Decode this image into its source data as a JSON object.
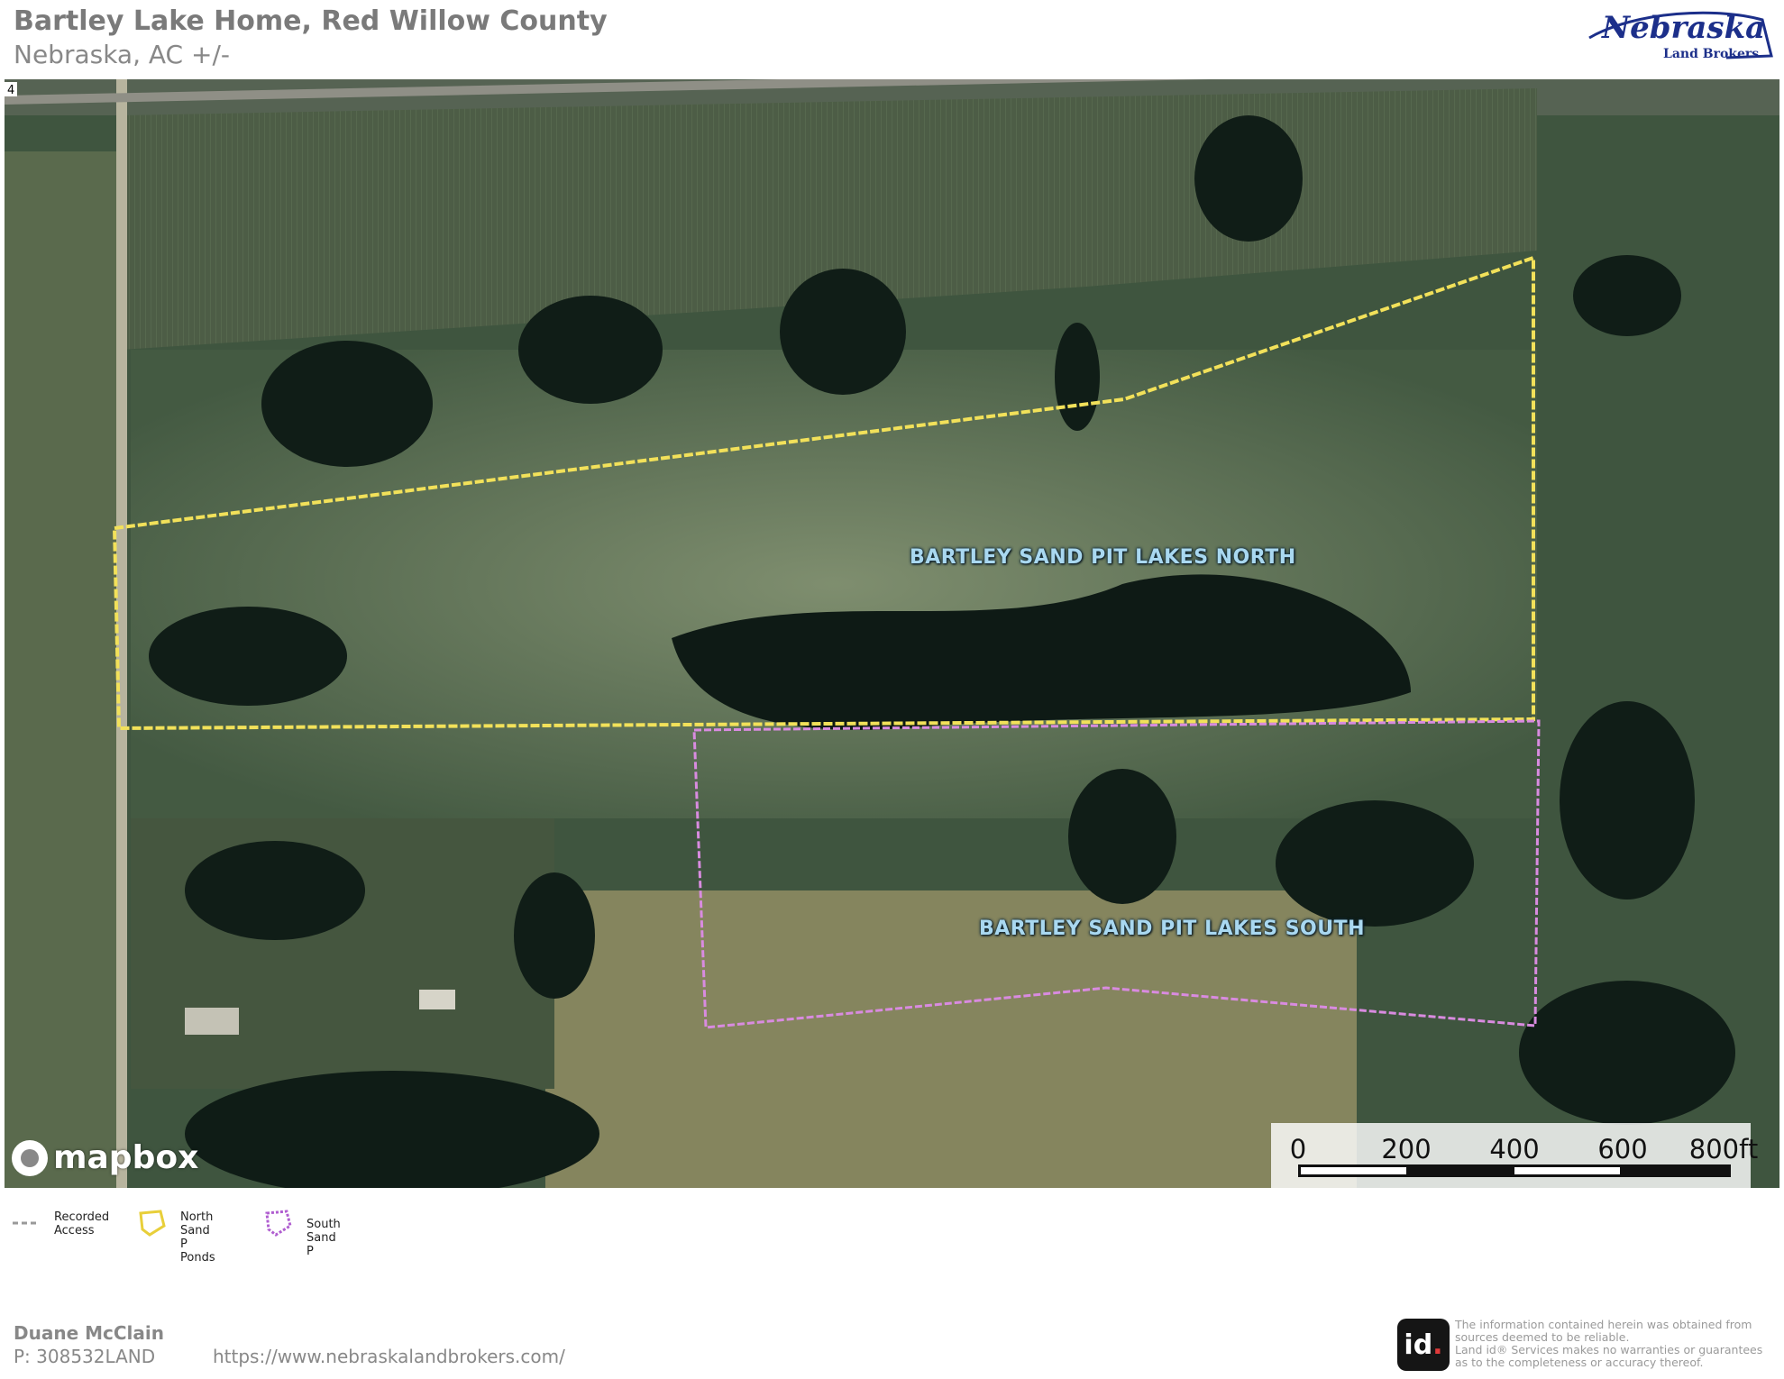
{
  "header": {
    "title": "Bartley Lake Home, Red Willow County",
    "subtitle": "Nebraska,  AC +/-"
  },
  "logo": {
    "brand_text": "Nebraska",
    "brand_sub": "Land Brokers"
  },
  "map": {
    "parcels": [
      {
        "label": "BARTLEY SAND PIT LAKES NORTH",
        "outline_color": "#f2e15a"
      },
      {
        "label": "BARTLEY SAND PIT LAKES SOUTH",
        "outline_color": "#d98be0"
      }
    ],
    "route_marker": "4",
    "attribution": "mapbox",
    "scalebar": {
      "labels": [
        "0",
        "200",
        "400",
        "600",
        "800ft"
      ]
    }
  },
  "legend": {
    "items": [
      {
        "label": "Recorded\nAccess",
        "icon": "dashed-line-icon",
        "color": "#9a9a9a"
      },
      {
        "label": "North Sand P\nPonds",
        "icon": "polygon-outline-icon",
        "color": "#e8cf3a"
      },
      {
        "label": "South Sand P",
        "icon": "polygon-outline-icon",
        "color": "#b05ed0"
      }
    ]
  },
  "footer": {
    "agent_name": "Duane McClain",
    "phone": "P: 308532LAND",
    "url": "https://www.nebraskalandbrokers.com/",
    "id_logo": "id",
    "disclaimer": "The information contained herein was obtained from\nsources deemed to be reliable.\n Land id® Services makes no warranties or guarantees\nas to the completeness or accuracy thereof."
  }
}
